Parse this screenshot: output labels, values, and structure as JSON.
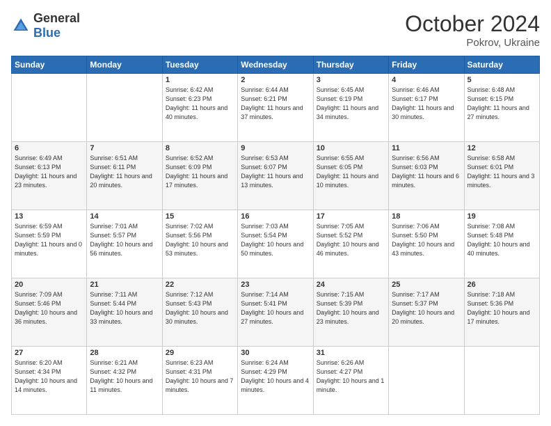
{
  "header": {
    "logo_general": "General",
    "logo_blue": "Blue",
    "month": "October 2024",
    "location": "Pokrov, Ukraine"
  },
  "days_of_week": [
    "Sunday",
    "Monday",
    "Tuesday",
    "Wednesday",
    "Thursday",
    "Friday",
    "Saturday"
  ],
  "weeks": [
    [
      {
        "day": "",
        "sunrise": "",
        "sunset": "",
        "daylight": ""
      },
      {
        "day": "",
        "sunrise": "",
        "sunset": "",
        "daylight": ""
      },
      {
        "day": "1",
        "sunrise": "Sunrise: 6:42 AM",
        "sunset": "Sunset: 6:23 PM",
        "daylight": "Daylight: 11 hours and 40 minutes."
      },
      {
        "day": "2",
        "sunrise": "Sunrise: 6:44 AM",
        "sunset": "Sunset: 6:21 PM",
        "daylight": "Daylight: 11 hours and 37 minutes."
      },
      {
        "day": "3",
        "sunrise": "Sunrise: 6:45 AM",
        "sunset": "Sunset: 6:19 PM",
        "daylight": "Daylight: 11 hours and 34 minutes."
      },
      {
        "day": "4",
        "sunrise": "Sunrise: 6:46 AM",
        "sunset": "Sunset: 6:17 PM",
        "daylight": "Daylight: 11 hours and 30 minutes."
      },
      {
        "day": "5",
        "sunrise": "Sunrise: 6:48 AM",
        "sunset": "Sunset: 6:15 PM",
        "daylight": "Daylight: 11 hours and 27 minutes."
      }
    ],
    [
      {
        "day": "6",
        "sunrise": "Sunrise: 6:49 AM",
        "sunset": "Sunset: 6:13 PM",
        "daylight": "Daylight: 11 hours and 23 minutes."
      },
      {
        "day": "7",
        "sunrise": "Sunrise: 6:51 AM",
        "sunset": "Sunset: 6:11 PM",
        "daylight": "Daylight: 11 hours and 20 minutes."
      },
      {
        "day": "8",
        "sunrise": "Sunrise: 6:52 AM",
        "sunset": "Sunset: 6:09 PM",
        "daylight": "Daylight: 11 hours and 17 minutes."
      },
      {
        "day": "9",
        "sunrise": "Sunrise: 6:53 AM",
        "sunset": "Sunset: 6:07 PM",
        "daylight": "Daylight: 11 hours and 13 minutes."
      },
      {
        "day": "10",
        "sunrise": "Sunrise: 6:55 AM",
        "sunset": "Sunset: 6:05 PM",
        "daylight": "Daylight: 11 hours and 10 minutes."
      },
      {
        "day": "11",
        "sunrise": "Sunrise: 6:56 AM",
        "sunset": "Sunset: 6:03 PM",
        "daylight": "Daylight: 11 hours and 6 minutes."
      },
      {
        "day": "12",
        "sunrise": "Sunrise: 6:58 AM",
        "sunset": "Sunset: 6:01 PM",
        "daylight": "Daylight: 11 hours and 3 minutes."
      }
    ],
    [
      {
        "day": "13",
        "sunrise": "Sunrise: 6:59 AM",
        "sunset": "Sunset: 5:59 PM",
        "daylight": "Daylight: 11 hours and 0 minutes."
      },
      {
        "day": "14",
        "sunrise": "Sunrise: 7:01 AM",
        "sunset": "Sunset: 5:57 PM",
        "daylight": "Daylight: 10 hours and 56 minutes."
      },
      {
        "day": "15",
        "sunrise": "Sunrise: 7:02 AM",
        "sunset": "Sunset: 5:56 PM",
        "daylight": "Daylight: 10 hours and 53 minutes."
      },
      {
        "day": "16",
        "sunrise": "Sunrise: 7:03 AM",
        "sunset": "Sunset: 5:54 PM",
        "daylight": "Daylight: 10 hours and 50 minutes."
      },
      {
        "day": "17",
        "sunrise": "Sunrise: 7:05 AM",
        "sunset": "Sunset: 5:52 PM",
        "daylight": "Daylight: 10 hours and 46 minutes."
      },
      {
        "day": "18",
        "sunrise": "Sunrise: 7:06 AM",
        "sunset": "Sunset: 5:50 PM",
        "daylight": "Daylight: 10 hours and 43 minutes."
      },
      {
        "day": "19",
        "sunrise": "Sunrise: 7:08 AM",
        "sunset": "Sunset: 5:48 PM",
        "daylight": "Daylight: 10 hours and 40 minutes."
      }
    ],
    [
      {
        "day": "20",
        "sunrise": "Sunrise: 7:09 AM",
        "sunset": "Sunset: 5:46 PM",
        "daylight": "Daylight: 10 hours and 36 minutes."
      },
      {
        "day": "21",
        "sunrise": "Sunrise: 7:11 AM",
        "sunset": "Sunset: 5:44 PM",
        "daylight": "Daylight: 10 hours and 33 minutes."
      },
      {
        "day": "22",
        "sunrise": "Sunrise: 7:12 AM",
        "sunset": "Sunset: 5:43 PM",
        "daylight": "Daylight: 10 hours and 30 minutes."
      },
      {
        "day": "23",
        "sunrise": "Sunrise: 7:14 AM",
        "sunset": "Sunset: 5:41 PM",
        "daylight": "Daylight: 10 hours and 27 minutes."
      },
      {
        "day": "24",
        "sunrise": "Sunrise: 7:15 AM",
        "sunset": "Sunset: 5:39 PM",
        "daylight": "Daylight: 10 hours and 23 minutes."
      },
      {
        "day": "25",
        "sunrise": "Sunrise: 7:17 AM",
        "sunset": "Sunset: 5:37 PM",
        "daylight": "Daylight: 10 hours and 20 minutes."
      },
      {
        "day": "26",
        "sunrise": "Sunrise: 7:18 AM",
        "sunset": "Sunset: 5:36 PM",
        "daylight": "Daylight: 10 hours and 17 minutes."
      }
    ],
    [
      {
        "day": "27",
        "sunrise": "Sunrise: 6:20 AM",
        "sunset": "Sunset: 4:34 PM",
        "daylight": "Daylight: 10 hours and 14 minutes."
      },
      {
        "day": "28",
        "sunrise": "Sunrise: 6:21 AM",
        "sunset": "Sunset: 4:32 PM",
        "daylight": "Daylight: 10 hours and 11 minutes."
      },
      {
        "day": "29",
        "sunrise": "Sunrise: 6:23 AM",
        "sunset": "Sunset: 4:31 PM",
        "daylight": "Daylight: 10 hours and 7 minutes."
      },
      {
        "day": "30",
        "sunrise": "Sunrise: 6:24 AM",
        "sunset": "Sunset: 4:29 PM",
        "daylight": "Daylight: 10 hours and 4 minutes."
      },
      {
        "day": "31",
        "sunrise": "Sunrise: 6:26 AM",
        "sunset": "Sunset: 4:27 PM",
        "daylight": "Daylight: 10 hours and 1 minute."
      },
      {
        "day": "",
        "sunrise": "",
        "sunset": "",
        "daylight": ""
      },
      {
        "day": "",
        "sunrise": "",
        "sunset": "",
        "daylight": ""
      }
    ]
  ]
}
